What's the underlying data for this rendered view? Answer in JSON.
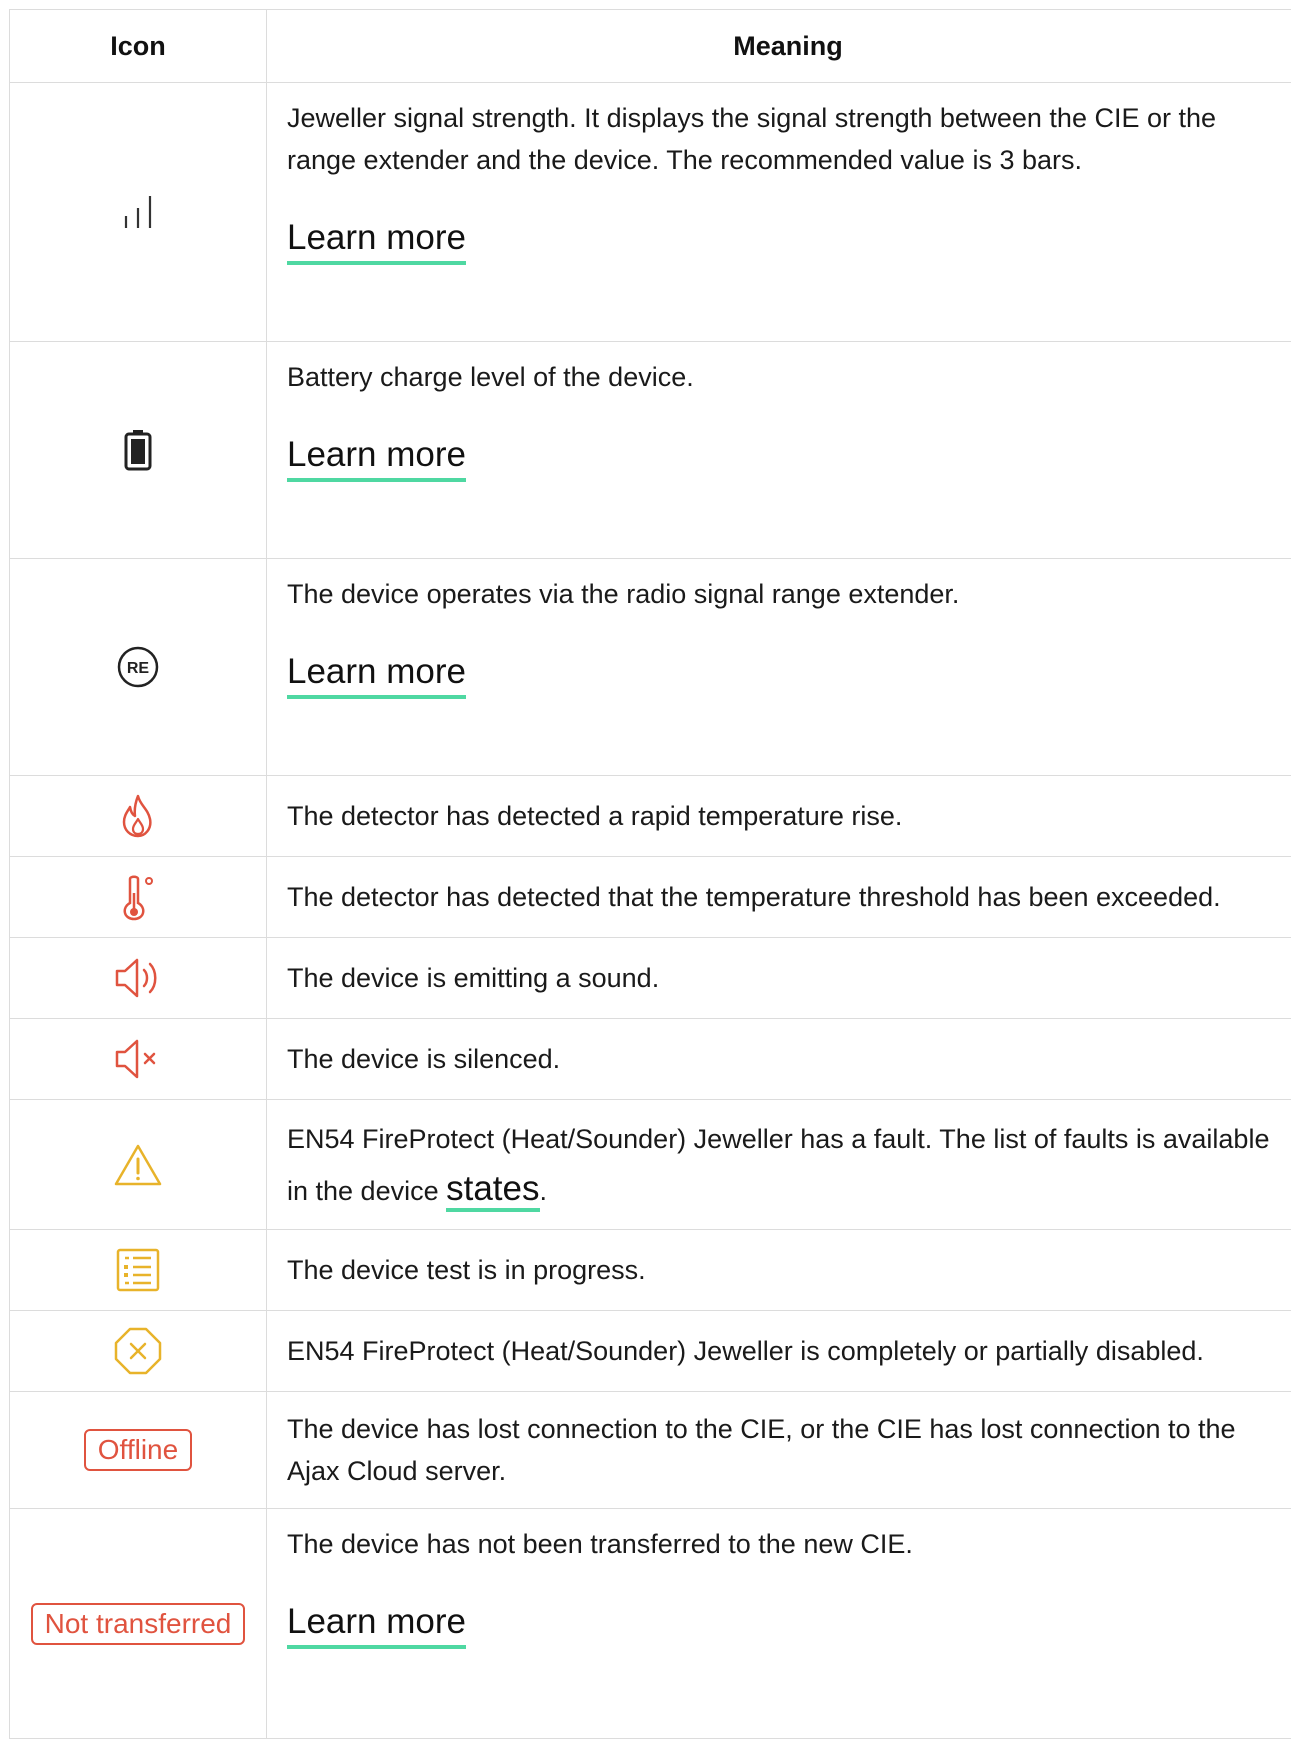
{
  "header": {
    "icon_col": "Icon",
    "meaning_col": "Meaning"
  },
  "rows": [
    {
      "icon": "signal-strength-icon",
      "text": "Jeweller signal strength. It displays the signal strength between the CIE or the range extender and the device. The recommended value is 3 bars.",
      "link": "Learn more"
    },
    {
      "icon": "battery-icon",
      "text": "Battery charge level of the device.",
      "link": "Learn more"
    },
    {
      "icon": "range-extender-icon",
      "icon_text": "RE",
      "text": "The device operates via the radio signal range extender.",
      "link": "Learn more"
    },
    {
      "icon": "fire-icon",
      "text": "The detector has detected a rapid temperature rise."
    },
    {
      "icon": "thermometer-icon",
      "text": "The detector has detected that the temperature threshold has been exceeded."
    },
    {
      "icon": "speaker-sound-icon",
      "text": "The device is emitting a sound."
    },
    {
      "icon": "speaker-muted-icon",
      "text": "The device is silenced."
    },
    {
      "icon": "warning-icon",
      "text": "EN54 FireProtect (Heat/Sounder) Jeweller has a fault. The list of faults is available in the device ",
      "link": "states",
      "suffix": "."
    },
    {
      "icon": "test-list-icon",
      "text": "The device test is in progress."
    },
    {
      "icon": "disabled-octagon-icon",
      "text": "EN54 FireProtect (Heat/Sounder) Jeweller is completely or partially disabled."
    },
    {
      "icon": "offline-badge",
      "badge": "Offline",
      "text": "The device has lost connection to the CIE, or the CIE has lost connection to the Ajax Cloud server."
    },
    {
      "icon": "not-transferred-badge",
      "badge": "Not transferred",
      "text": "The device has not been transferred to the new CIE.",
      "link": "Learn more"
    }
  ],
  "colors": {
    "accent_underline": "#4fd8a2",
    "alert_red": "#e0533f",
    "warning_yellow": "#e8b32a",
    "border": "#dcdcdc"
  }
}
